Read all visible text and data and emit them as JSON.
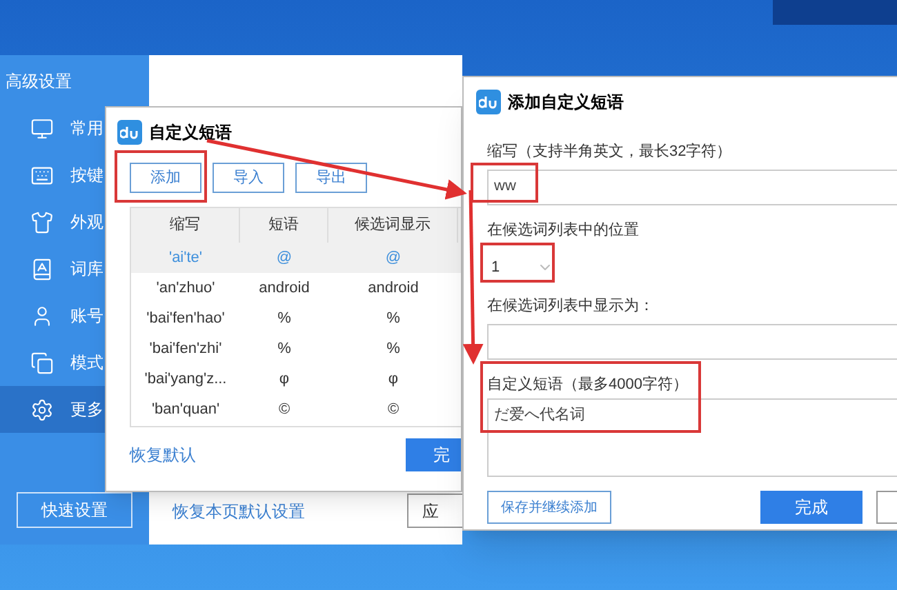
{
  "settings_window": {
    "title": "高级设置",
    "sidebar": {
      "items": [
        {
          "label": "常用",
          "selected": false
        },
        {
          "label": "按键",
          "selected": false
        },
        {
          "label": "外观",
          "selected": false
        },
        {
          "label": "词库",
          "selected": false
        },
        {
          "label": "账号",
          "selected": false
        },
        {
          "label": "模式",
          "selected": false
        },
        {
          "label": "更多",
          "selected": true
        }
      ]
    },
    "quick_settings_button": "快速设置",
    "restore_page_link": "恢复本页默认设置",
    "apply_button": "应"
  },
  "phrase_dialog": {
    "title": "自定义短语",
    "toolbar": [
      "添加",
      "导入",
      "导出"
    ],
    "table": {
      "columns": [
        "缩写",
        "短语",
        "候选词显示"
      ],
      "rows": [
        {
          "cells": [
            "'ai'te'",
            "@",
            "@"
          ],
          "selected": true
        },
        {
          "cells": [
            "'an'zhuo'",
            "android",
            "android"
          ],
          "selected": false
        },
        {
          "cells": [
            "'bai'fen'hao'",
            "%",
            "%"
          ],
          "selected": false
        },
        {
          "cells": [
            "'bai'fen'zhi'",
            "%",
            "%"
          ],
          "selected": false
        },
        {
          "cells": [
            "'bai'yang'z...",
            "φ",
            "φ"
          ],
          "selected": false
        },
        {
          "cells": [
            "'ban'quan'",
            "©",
            "©"
          ],
          "selected": false
        }
      ]
    },
    "restore_link": "恢复默认",
    "done_button": "完"
  },
  "add_dialog": {
    "title": "添加自定义短语",
    "abbr_label": "缩写（支持半角英文，最长32字符）",
    "abbr_value": "ww",
    "position_label": "在候选词列表中的位置",
    "position_value": "1",
    "display_label": "在候选词列表中显示为：",
    "phrase_label": "自定义短语（最多4000字符）",
    "phrase_value": "だ爱へ代名词",
    "save_continue_button": "保存并继续添加",
    "done_button": "完成"
  }
}
